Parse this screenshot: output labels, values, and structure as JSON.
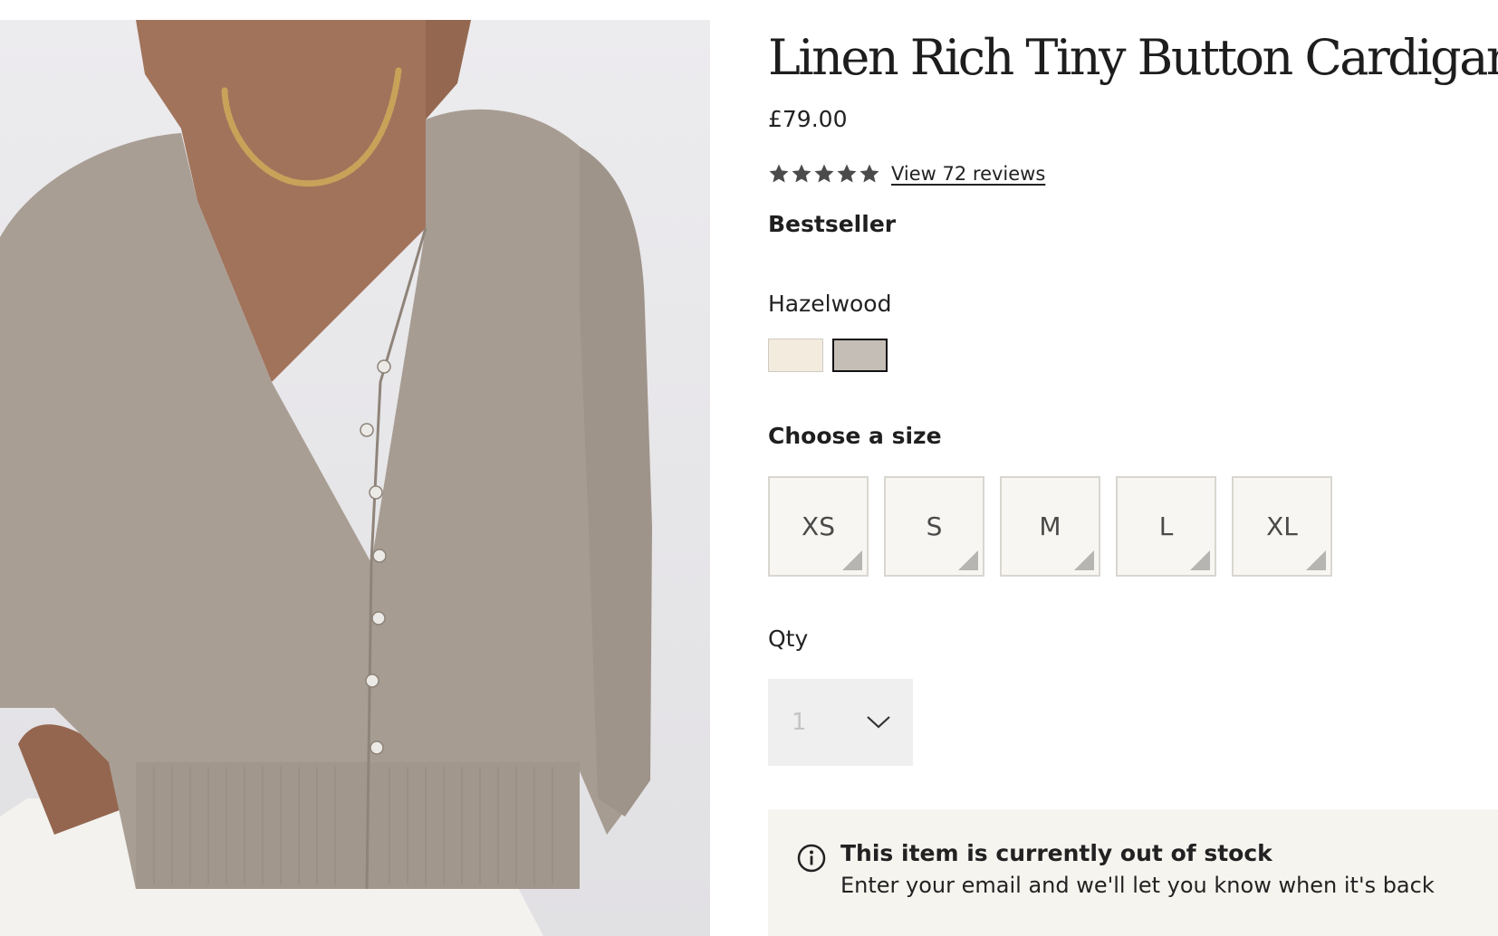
{
  "product": {
    "title": "Linen Rich Tiny Button Cardigan",
    "price": "£79.00",
    "rating": {
      "stars": 5,
      "reviews_link": "View 72 reviews"
    },
    "badge": "Bestseller",
    "image_alt": "Model wearing the cardigan"
  },
  "colour": {
    "selected_label": "Hazelwood",
    "swatches": [
      {
        "color": "#f4ebdf",
        "selected": false
      },
      {
        "color": "#c5beb7",
        "selected": true
      }
    ]
  },
  "size": {
    "label": "Choose a size",
    "options": [
      "XS",
      "S",
      "M",
      "L",
      "XL"
    ]
  },
  "quantity": {
    "label": "Qty",
    "value": "1"
  },
  "stock_notice": {
    "title": "This item is currently out of stock",
    "message": "Enter your email and we'll let you know when it's back"
  },
  "colors": {
    "text": "#222222",
    "notice_bg": "#f6f4ef",
    "size_bg": "#f7f6f2",
    "cardigan": "#a99e94"
  }
}
